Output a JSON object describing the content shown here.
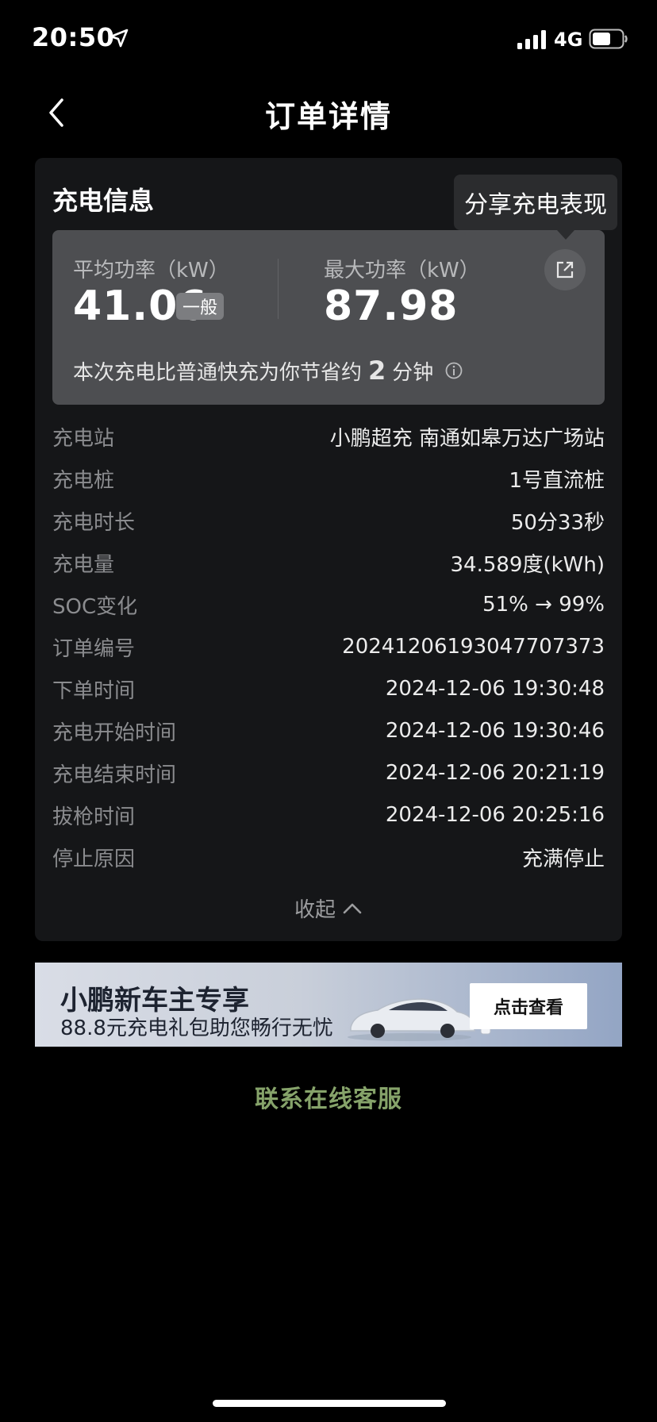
{
  "status_bar": {
    "time": "20:50",
    "network": "4G"
  },
  "nav": {
    "title": "订单详情"
  },
  "charging_info": {
    "section_title": "充电信息",
    "share_tooltip": "分享充电表现",
    "avg_power_label": "平均功率（kW）",
    "avg_power_value": "41.06",
    "avg_level": "一般",
    "max_power_label": "最大功率（kW）",
    "max_power_value": "87.98",
    "saving_prefix": "本次充电比普通快充为你节省约",
    "saving_value": "2",
    "saving_suffix": "分钟"
  },
  "details": [
    {
      "label": "充电站",
      "value": "小鹏超充 南通如皋万达广场站"
    },
    {
      "label": "充电桩",
      "value": "1号直流桩"
    },
    {
      "label": "充电时长",
      "value": "50分33秒"
    },
    {
      "label": "充电量",
      "value": "34.589度(kWh)"
    },
    {
      "label": "SOC变化",
      "value": "51% → 99%"
    },
    {
      "label": "订单编号",
      "value": "20241206193047707373"
    },
    {
      "label": "下单时间",
      "value": "2024-12-06 19:30:48"
    },
    {
      "label": "充电开始时间",
      "value": "2024-12-06 19:30:46"
    },
    {
      "label": "充电结束时间",
      "value": "2024-12-06 20:21:19"
    },
    {
      "label": "拔枪时间",
      "value": "2024-12-06 20:25:16"
    },
    {
      "label": "停止原因",
      "value": "充满停止"
    }
  ],
  "collapse_label": "收起",
  "banner": {
    "title": "小鹏新车主专享",
    "subtitle": "88.8元充电礼包助您畅行无忧",
    "button": "点击查看"
  },
  "service_link": "联系在线客服",
  "colors": {
    "background": "#000000",
    "card": "#151618",
    "accent_link": "#86a36a"
  }
}
